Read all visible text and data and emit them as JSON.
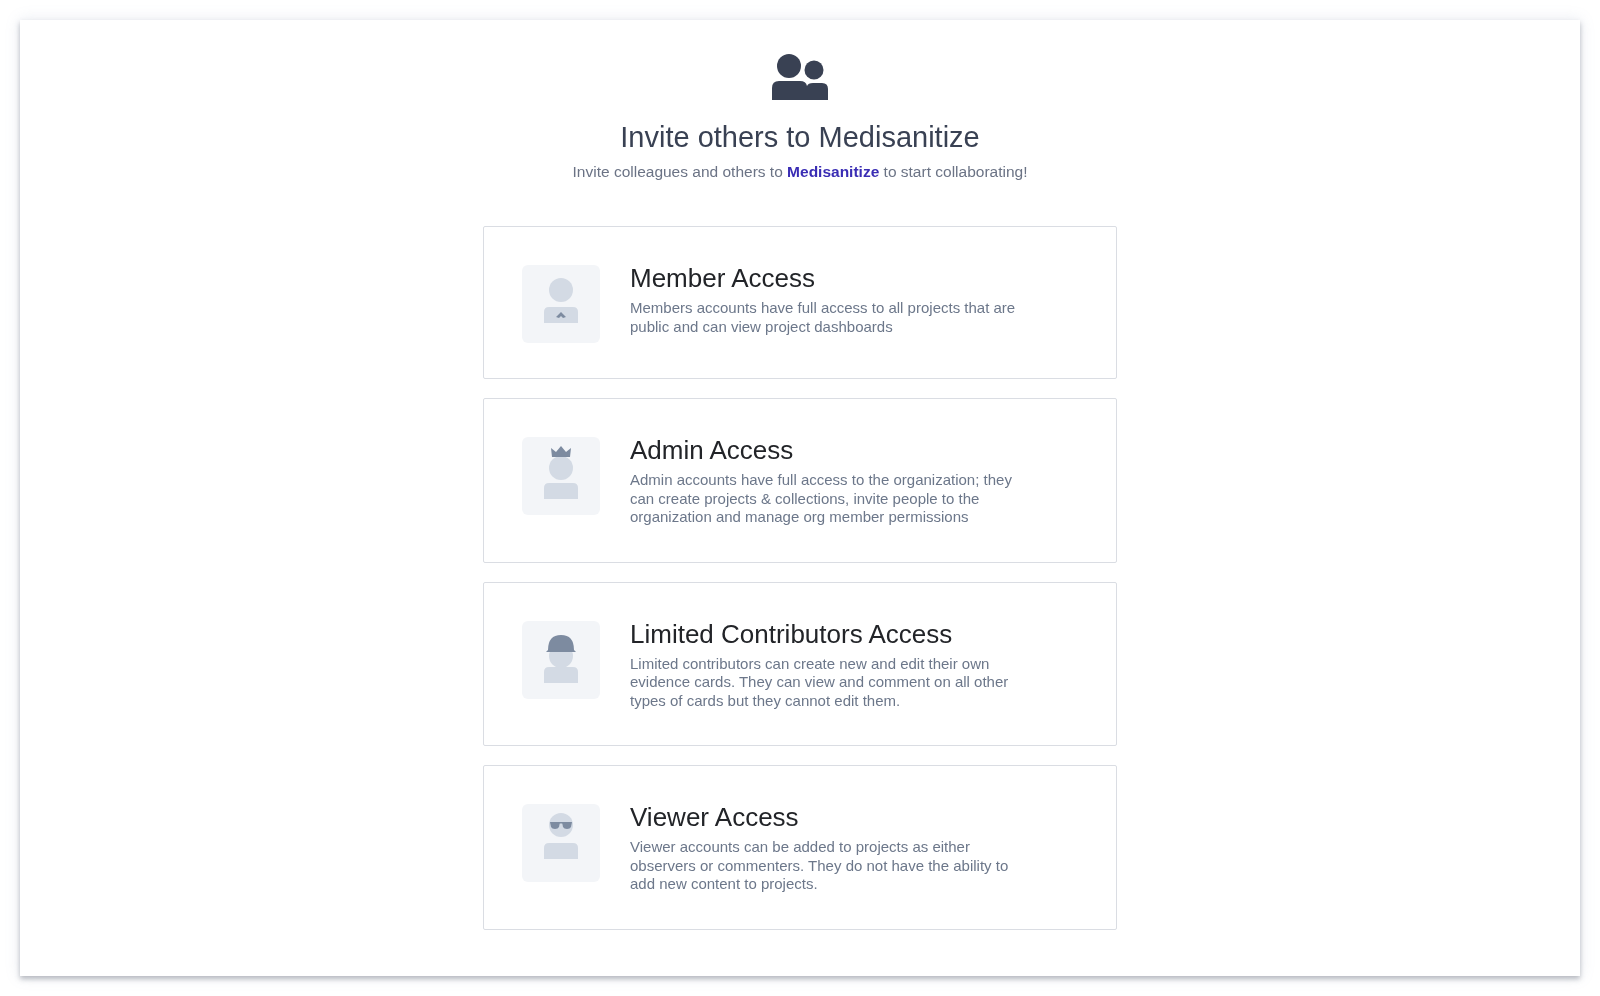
{
  "header": {
    "title": "Invite others to Medisanitize",
    "subtitle": "Invite colleagues and others to **Medisanitize** to start collaborating!"
  },
  "access_options": [
    {
      "kind": "member",
      "title": "Member Access",
      "description": "Members accounts have full access to all projects that are public and can view project dashboards"
    },
    {
      "kind": "admin",
      "title": "Admin Access",
      "description": "Admin accounts have full access to the organization; they can create projects & collections, invite people to the organization and manage org member permissions"
    },
    {
      "kind": "limited",
      "title": "Limited Contributors Access",
      "description": "Limited contributors can create new and edit their own evidence cards. They can view and comment on all other types of cards but they cannot edit them."
    },
    {
      "kind": "viewer",
      "title": "Viewer Access",
      "description": "Viewer accounts can be added to projects as either observers or commenters. They do not have the ability to add new content to projects."
    }
  ]
}
